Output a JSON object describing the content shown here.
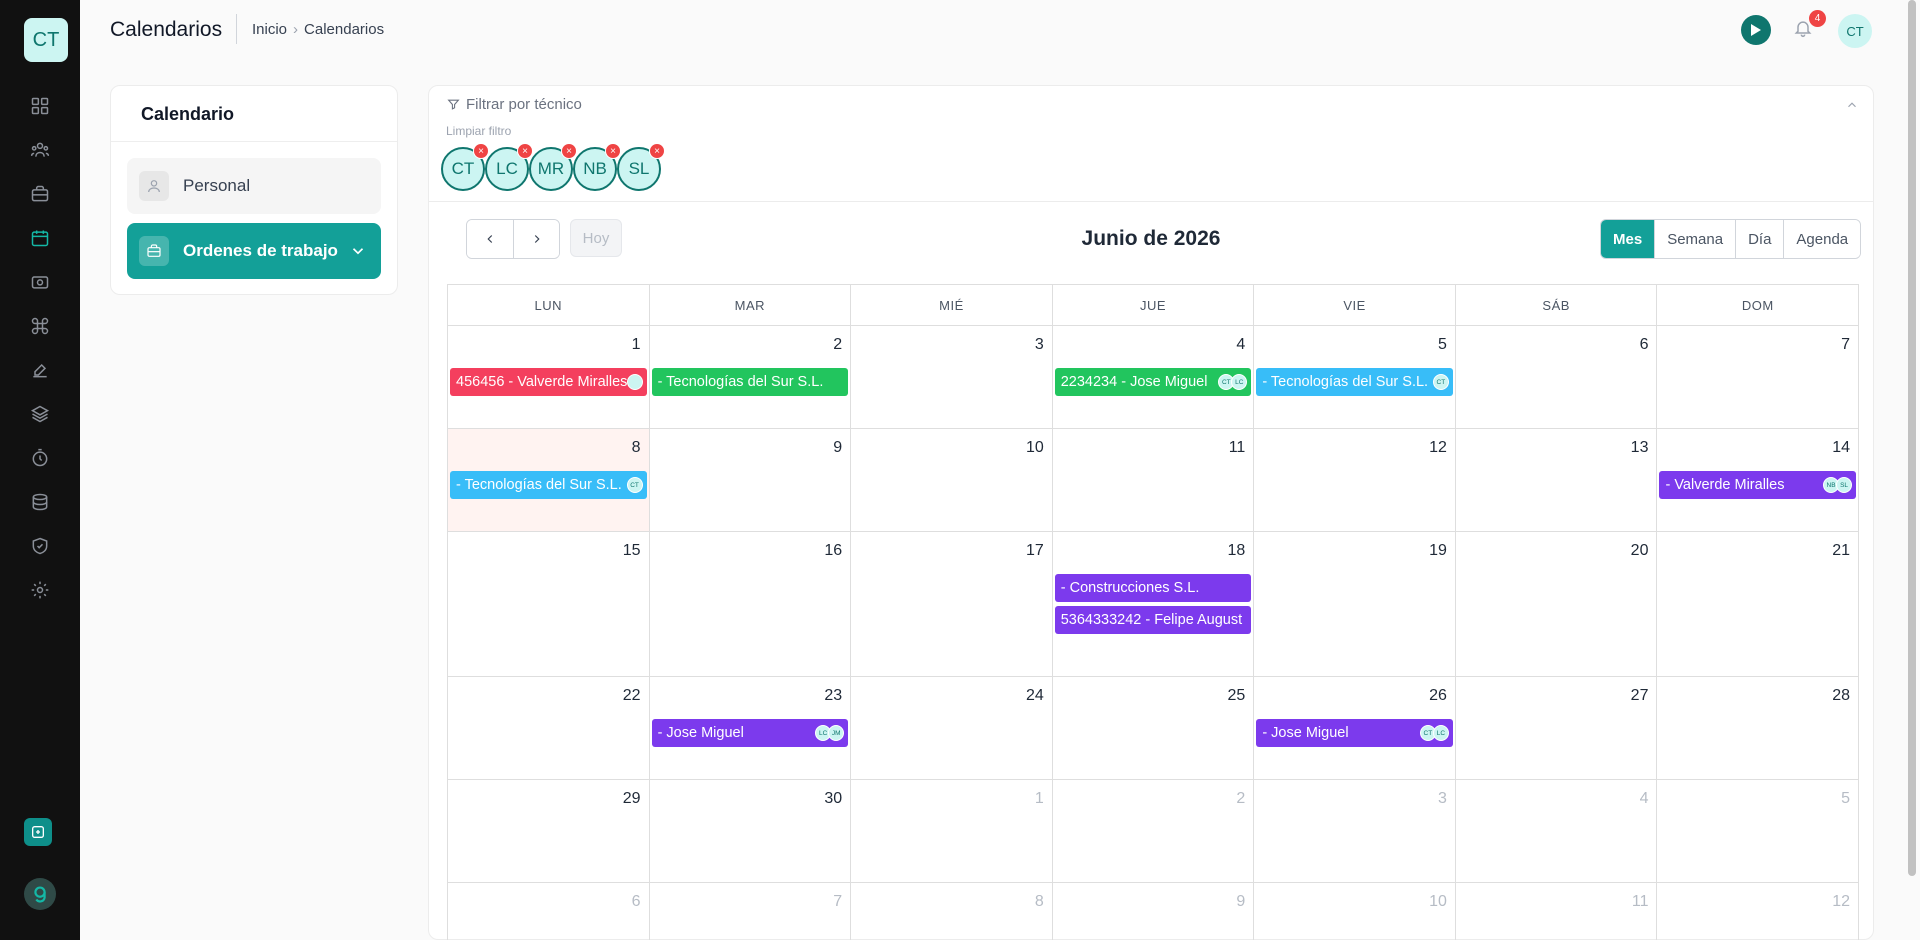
{
  "app": {
    "logo_text": "CT",
    "user_initials": "CT",
    "notification_count": "4"
  },
  "sidebar": {
    "items": [
      {
        "icon": "dashboard-icon"
      },
      {
        "icon": "users-icon"
      },
      {
        "icon": "briefcase-icon"
      },
      {
        "icon": "calendar-icon",
        "active": true
      },
      {
        "icon": "camera-icon"
      },
      {
        "icon": "command-icon"
      },
      {
        "icon": "tools-icon"
      },
      {
        "icon": "layers-icon"
      },
      {
        "icon": "timer-icon"
      },
      {
        "icon": "stack-icon"
      },
      {
        "icon": "shield-icon"
      },
      {
        "icon": "settings-icon"
      }
    ]
  },
  "header": {
    "title": "Calendarios",
    "breadcrumb": [
      "Inicio",
      "Calendarios"
    ]
  },
  "calendar_card": {
    "title": "Calendario",
    "items": [
      {
        "label": "Personal",
        "selected": false
      },
      {
        "label": "Ordenes de trabajo",
        "selected": true
      }
    ]
  },
  "filter": {
    "title": "Filtrar por técnico",
    "clear_label": "Limpiar filtro",
    "technicians": [
      "CT",
      "LC",
      "MR",
      "NB",
      "SL"
    ]
  },
  "toolbar": {
    "today_label": "Hoy",
    "month_title": "Junio de 2026",
    "views": [
      "Mes",
      "Semana",
      "Día",
      "Agenda"
    ],
    "active_view": "Mes"
  },
  "weekdays": [
    "LUN",
    "MAR",
    "MIÉ",
    "JUE",
    "VIE",
    "SÁB",
    "DOM"
  ],
  "weeks": [
    {
      "days": [
        {
          "n": "1",
          "events": [
            {
              "text": "456456 - Valverde Miralles",
              "color": "red",
              "avatars": [
                ""
              ]
            }
          ]
        },
        {
          "n": "2",
          "events": [
            {
              "text": "- Tecnologías del Sur S.L.",
              "color": "green",
              "avatars": []
            }
          ]
        },
        {
          "n": "3",
          "events": []
        },
        {
          "n": "4",
          "events": [
            {
              "text": "2234234 - Jose Miguel",
              "color": "green",
              "avatars": [
                "CT",
                "LC"
              ]
            }
          ]
        },
        {
          "n": "5",
          "events": [
            {
              "text": "- Tecnologías del Sur S.L.",
              "color": "blue",
              "avatars": [
                "CT"
              ]
            }
          ]
        },
        {
          "n": "6",
          "events": []
        },
        {
          "n": "7",
          "events": []
        }
      ]
    },
    {
      "days": [
        {
          "n": "8",
          "today": true,
          "events": [
            {
              "text": "- Tecnologías del Sur S.L.",
              "color": "blue",
              "avatars": [
                "CT"
              ]
            }
          ]
        },
        {
          "n": "9",
          "events": []
        },
        {
          "n": "10",
          "events": []
        },
        {
          "n": "11",
          "events": []
        },
        {
          "n": "12",
          "events": []
        },
        {
          "n": "13",
          "events": []
        },
        {
          "n": "14",
          "events": [
            {
              "text": "- Valverde Miralles",
              "color": "purple",
              "avatars": [
                "NB",
                "SL"
              ]
            }
          ]
        }
      ]
    },
    {
      "days": [
        {
          "n": "15",
          "events": []
        },
        {
          "n": "16",
          "events": []
        },
        {
          "n": "17",
          "events": []
        },
        {
          "n": "18",
          "events": [
            {
              "text": "- Construcciones S.L.",
              "color": "purple",
              "avatars": []
            },
            {
              "text": "5364333242 - Felipe August",
              "color": "purple",
              "avatars": []
            }
          ]
        },
        {
          "n": "19",
          "events": []
        },
        {
          "n": "20",
          "events": []
        },
        {
          "n": "21",
          "events": []
        }
      ]
    },
    {
      "days": [
        {
          "n": "22",
          "events": []
        },
        {
          "n": "23",
          "events": [
            {
              "text": "- Jose Miguel",
              "color": "purple",
              "avatars": [
                "LC",
                "JM"
              ]
            }
          ]
        },
        {
          "n": "24",
          "events": []
        },
        {
          "n": "25",
          "events": []
        },
        {
          "n": "26",
          "events": [
            {
              "text": "- Jose Miguel",
              "color": "purple",
              "avatars": [
                "CT",
                "LC"
              ]
            }
          ]
        },
        {
          "n": "27",
          "events": []
        },
        {
          "n": "28",
          "events": []
        }
      ]
    },
    {
      "days": [
        {
          "n": "29",
          "events": []
        },
        {
          "n": "30",
          "events": []
        },
        {
          "n": "1",
          "other": true,
          "events": []
        },
        {
          "n": "2",
          "other": true,
          "events": []
        },
        {
          "n": "3",
          "other": true,
          "events": []
        },
        {
          "n": "4",
          "other": true,
          "events": []
        },
        {
          "n": "5",
          "other": true,
          "events": []
        }
      ]
    },
    {
      "days": [
        {
          "n": "6",
          "other": true,
          "events": []
        },
        {
          "n": "7",
          "other": true,
          "events": []
        },
        {
          "n": "8",
          "other": true,
          "events": []
        },
        {
          "n": "9",
          "other": true,
          "events": []
        },
        {
          "n": "10",
          "other": true,
          "events": []
        },
        {
          "n": "11",
          "other": true,
          "events": []
        },
        {
          "n": "12",
          "other": true,
          "events": []
        }
      ]
    }
  ]
}
